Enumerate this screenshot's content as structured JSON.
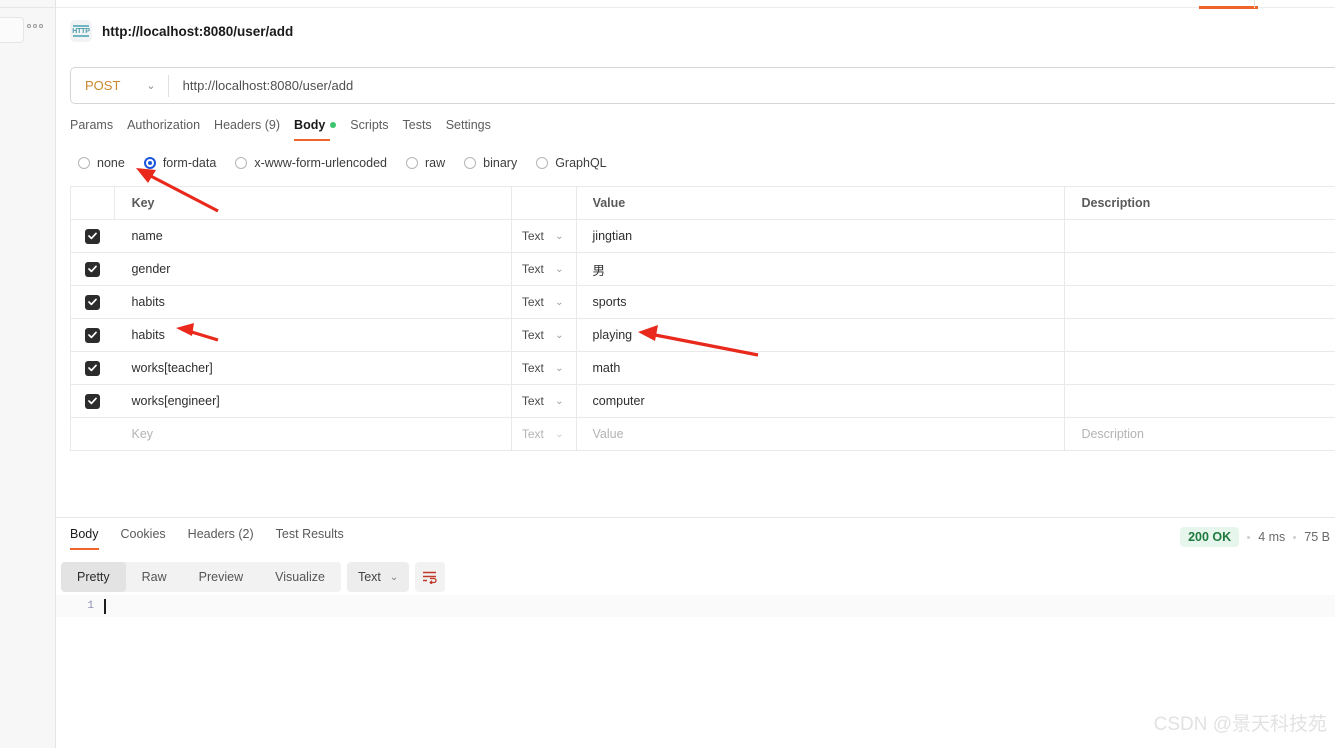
{
  "window": {
    "watermark": "CSDN @景天科技苑"
  },
  "sidebar": {
    "more_label": "···"
  },
  "request": {
    "protocol_badge": "HTTP",
    "title": "http://localhost:8080/user/add",
    "method": "POST",
    "method_chevron": "⌄",
    "url": "http://localhost:8080/user/add",
    "tabs": [
      {
        "label": "Params",
        "active": false
      },
      {
        "label": "Authorization",
        "active": false
      },
      {
        "label": "Headers (9)",
        "active": false
      },
      {
        "label": "Body",
        "active": true,
        "dot": true
      },
      {
        "label": "Scripts",
        "active": false
      },
      {
        "label": "Tests",
        "active": false
      },
      {
        "label": "Settings",
        "active": false
      }
    ],
    "body_types": [
      {
        "label": "none",
        "selected": false
      },
      {
        "label": "form-data",
        "selected": true
      },
      {
        "label": "x-www-form-urlencoded",
        "selected": false
      },
      {
        "label": "raw",
        "selected": false
      },
      {
        "label": "binary",
        "selected": false
      },
      {
        "label": "GraphQL",
        "selected": false
      }
    ]
  },
  "form_table": {
    "columns": {
      "key": "Key",
      "value": "Value",
      "description": "Description"
    },
    "placeholders": {
      "key": "Key",
      "value": "Value",
      "description": "Description",
      "type": "Text"
    },
    "chevron": "⌄",
    "rows": [
      {
        "checked": true,
        "key": "name",
        "type": "Text",
        "value": "jingtian",
        "description": ""
      },
      {
        "checked": true,
        "key": "gender",
        "type": "Text",
        "value": "男",
        "description": ""
      },
      {
        "checked": true,
        "key": "habits",
        "type": "Text",
        "value": "sports",
        "description": ""
      },
      {
        "checked": true,
        "key": "habits",
        "type": "Text",
        "value": "playing",
        "description": ""
      },
      {
        "checked": true,
        "key": "works[teacher]",
        "type": "Text",
        "value": "math",
        "description": ""
      },
      {
        "checked": true,
        "key": "works[engineer]",
        "type": "Text",
        "value": "computer",
        "description": ""
      }
    ]
  },
  "response": {
    "tabs": [
      {
        "label": "Body",
        "active": true
      },
      {
        "label": "Cookies",
        "active": false
      },
      {
        "label": "Headers (2)",
        "active": false
      },
      {
        "label": "Test Results",
        "active": false
      }
    ],
    "status": "200 OK",
    "time": "4 ms",
    "size": "75 B",
    "view_modes": [
      {
        "label": "Pretty",
        "active": true
      },
      {
        "label": "Raw",
        "active": false
      },
      {
        "label": "Preview",
        "active": false
      },
      {
        "label": "Visualize",
        "active": false
      }
    ],
    "format": "Text",
    "format_chevron": "⌄",
    "line_number": "1",
    "body_text": ""
  },
  "colors": {
    "accent_orange": "#f0642b",
    "selected_blue": "#1a56db",
    "status_green": "#1f7a3f",
    "body_dot_green": "#3ec46d",
    "annotation_red": "#e8291c"
  }
}
